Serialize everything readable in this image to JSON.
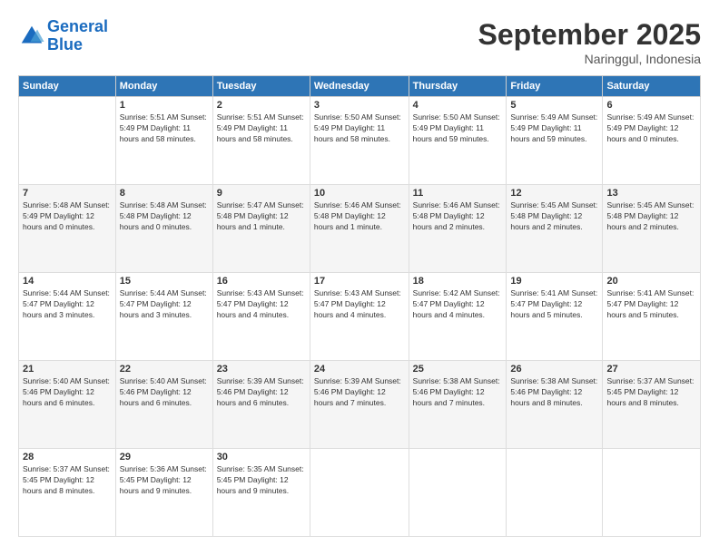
{
  "header": {
    "logo_line1": "General",
    "logo_line2": "Blue",
    "month_title": "September 2025",
    "subtitle": "Naringgul, Indonesia"
  },
  "days_of_week": [
    "Sunday",
    "Monday",
    "Tuesday",
    "Wednesday",
    "Thursday",
    "Friday",
    "Saturday"
  ],
  "weeks": [
    [
      {
        "day": "",
        "info": ""
      },
      {
        "day": "1",
        "info": "Sunrise: 5:51 AM\nSunset: 5:49 PM\nDaylight: 11 hours\nand 58 minutes."
      },
      {
        "day": "2",
        "info": "Sunrise: 5:51 AM\nSunset: 5:49 PM\nDaylight: 11 hours\nand 58 minutes."
      },
      {
        "day": "3",
        "info": "Sunrise: 5:50 AM\nSunset: 5:49 PM\nDaylight: 11 hours\nand 58 minutes."
      },
      {
        "day": "4",
        "info": "Sunrise: 5:50 AM\nSunset: 5:49 PM\nDaylight: 11 hours\nand 59 minutes."
      },
      {
        "day": "5",
        "info": "Sunrise: 5:49 AM\nSunset: 5:49 PM\nDaylight: 11 hours\nand 59 minutes."
      },
      {
        "day": "6",
        "info": "Sunrise: 5:49 AM\nSunset: 5:49 PM\nDaylight: 12 hours\nand 0 minutes."
      }
    ],
    [
      {
        "day": "7",
        "info": "Sunrise: 5:48 AM\nSunset: 5:49 PM\nDaylight: 12 hours\nand 0 minutes."
      },
      {
        "day": "8",
        "info": "Sunrise: 5:48 AM\nSunset: 5:48 PM\nDaylight: 12 hours\nand 0 minutes."
      },
      {
        "day": "9",
        "info": "Sunrise: 5:47 AM\nSunset: 5:48 PM\nDaylight: 12 hours\nand 1 minute."
      },
      {
        "day": "10",
        "info": "Sunrise: 5:46 AM\nSunset: 5:48 PM\nDaylight: 12 hours\nand 1 minute."
      },
      {
        "day": "11",
        "info": "Sunrise: 5:46 AM\nSunset: 5:48 PM\nDaylight: 12 hours\nand 2 minutes."
      },
      {
        "day": "12",
        "info": "Sunrise: 5:45 AM\nSunset: 5:48 PM\nDaylight: 12 hours\nand 2 minutes."
      },
      {
        "day": "13",
        "info": "Sunrise: 5:45 AM\nSunset: 5:48 PM\nDaylight: 12 hours\nand 2 minutes."
      }
    ],
    [
      {
        "day": "14",
        "info": "Sunrise: 5:44 AM\nSunset: 5:47 PM\nDaylight: 12 hours\nand 3 minutes."
      },
      {
        "day": "15",
        "info": "Sunrise: 5:44 AM\nSunset: 5:47 PM\nDaylight: 12 hours\nand 3 minutes."
      },
      {
        "day": "16",
        "info": "Sunrise: 5:43 AM\nSunset: 5:47 PM\nDaylight: 12 hours\nand 4 minutes."
      },
      {
        "day": "17",
        "info": "Sunrise: 5:43 AM\nSunset: 5:47 PM\nDaylight: 12 hours\nand 4 minutes."
      },
      {
        "day": "18",
        "info": "Sunrise: 5:42 AM\nSunset: 5:47 PM\nDaylight: 12 hours\nand 4 minutes."
      },
      {
        "day": "19",
        "info": "Sunrise: 5:41 AM\nSunset: 5:47 PM\nDaylight: 12 hours\nand 5 minutes."
      },
      {
        "day": "20",
        "info": "Sunrise: 5:41 AM\nSunset: 5:47 PM\nDaylight: 12 hours\nand 5 minutes."
      }
    ],
    [
      {
        "day": "21",
        "info": "Sunrise: 5:40 AM\nSunset: 5:46 PM\nDaylight: 12 hours\nand 6 minutes."
      },
      {
        "day": "22",
        "info": "Sunrise: 5:40 AM\nSunset: 5:46 PM\nDaylight: 12 hours\nand 6 minutes."
      },
      {
        "day": "23",
        "info": "Sunrise: 5:39 AM\nSunset: 5:46 PM\nDaylight: 12 hours\nand 6 minutes."
      },
      {
        "day": "24",
        "info": "Sunrise: 5:39 AM\nSunset: 5:46 PM\nDaylight: 12 hours\nand 7 minutes."
      },
      {
        "day": "25",
        "info": "Sunrise: 5:38 AM\nSunset: 5:46 PM\nDaylight: 12 hours\nand 7 minutes."
      },
      {
        "day": "26",
        "info": "Sunrise: 5:38 AM\nSunset: 5:46 PM\nDaylight: 12 hours\nand 8 minutes."
      },
      {
        "day": "27",
        "info": "Sunrise: 5:37 AM\nSunset: 5:45 PM\nDaylight: 12 hours\nand 8 minutes."
      }
    ],
    [
      {
        "day": "28",
        "info": "Sunrise: 5:37 AM\nSunset: 5:45 PM\nDaylight: 12 hours\nand 8 minutes."
      },
      {
        "day": "29",
        "info": "Sunrise: 5:36 AM\nSunset: 5:45 PM\nDaylight: 12 hours\nand 9 minutes."
      },
      {
        "day": "30",
        "info": "Sunrise: 5:35 AM\nSunset: 5:45 PM\nDaylight: 12 hours\nand 9 minutes."
      },
      {
        "day": "",
        "info": ""
      },
      {
        "day": "",
        "info": ""
      },
      {
        "day": "",
        "info": ""
      },
      {
        "day": "",
        "info": ""
      }
    ]
  ]
}
